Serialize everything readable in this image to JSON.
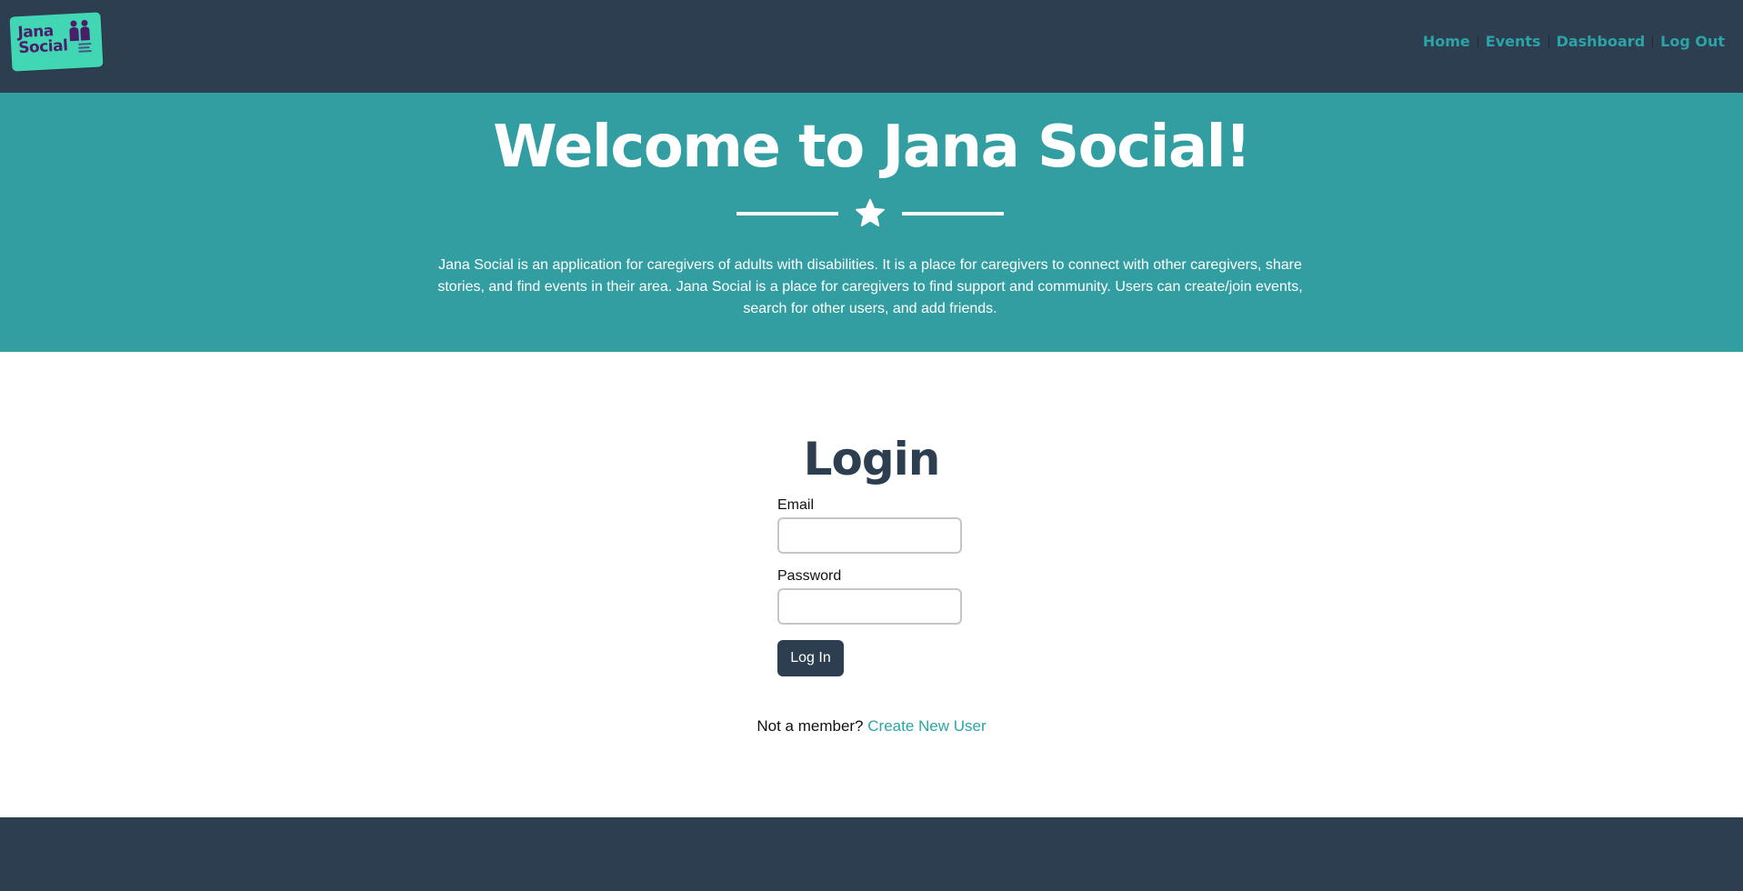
{
  "brand": {
    "logo_line1": "Jana",
    "logo_line2": "Social",
    "logo_icon": "people-icon",
    "colors": {
      "logo_bg": "#41d6b4",
      "logo_text": "#4a1e69"
    }
  },
  "nav": {
    "items": [
      {
        "label": "Home"
      },
      {
        "label": "Events"
      },
      {
        "label": "Dashboard"
      },
      {
        "label": "Log Out"
      }
    ],
    "link_color": "#2aa4a6"
  },
  "hero": {
    "title": "Welcome to Jana Social!",
    "divider_icon": "star-icon",
    "description": "Jana Social is an application for caregivers of adults with disabilities. It is a place for caregivers to connect with other caregivers, share stories, and find events in their area. Jana Social is a place for caregivers to find support and community. Users can create/join events, search for other users, and add friends.",
    "bg_color": "#339ea2"
  },
  "login": {
    "title": "Login",
    "email_label": "Email",
    "email_value": "",
    "password_label": "Password",
    "password_value": "",
    "submit_label": "Log In",
    "signup_prompt": "Not a member?",
    "signup_link": "Create New User"
  },
  "theme": {
    "dark": "#2c3e50",
    "accent": "#2aa4a6"
  }
}
